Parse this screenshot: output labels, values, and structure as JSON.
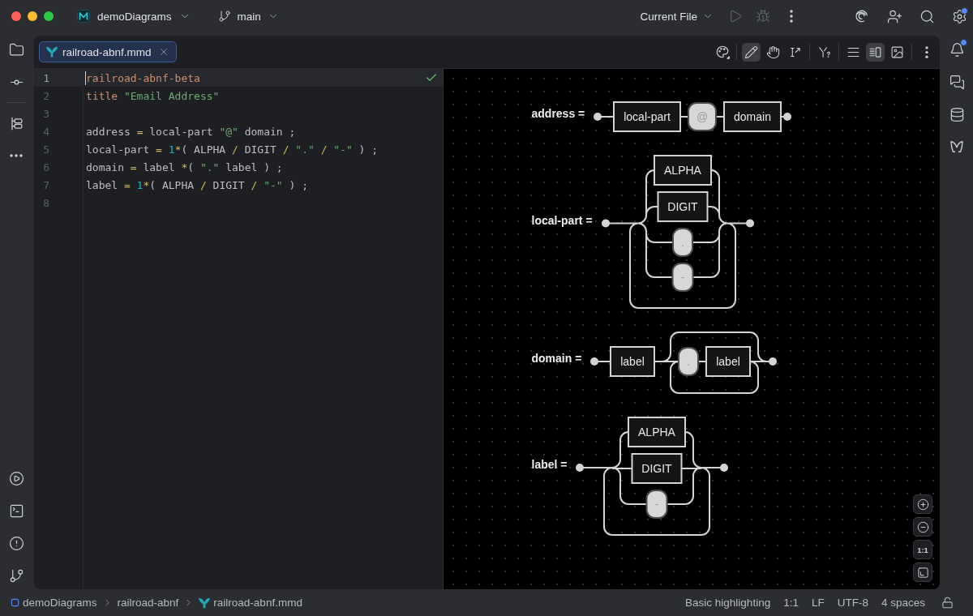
{
  "title_bar": {
    "project": "demoDiagrams",
    "branch": "main",
    "run_configuration": "Current File",
    "run_disabled": true,
    "debug_disabled": true,
    "settings_badge": true
  },
  "right_stripe": {
    "notifications_badge": true
  },
  "editor_tabs": [
    {
      "label": "railroad-abnf.mmd",
      "selected": true
    }
  ],
  "preview_toolbar": {
    "tools": [
      {
        "kind": "draw",
        "selected": true
      },
      {
        "kind": "pan",
        "selected": false
      },
      {
        "kind": "text",
        "selected": false
      }
    ],
    "layouts": [
      {
        "kind": "editor",
        "selected": false
      },
      {
        "kind": "split",
        "selected": true
      },
      {
        "kind": "preview",
        "selected": false
      }
    ]
  },
  "editor": {
    "inspection_passed": true,
    "lines": [
      {
        "number": "1",
        "current": true,
        "tokens": [
          {
            "kind": "keyword",
            "text": "railroad-abnf-beta"
          }
        ]
      },
      {
        "number": "2",
        "current": false,
        "tokens": [
          {
            "kind": "keyword",
            "text": "title"
          },
          {
            "kind": "string",
            "text": " \"Email Address\""
          }
        ]
      },
      {
        "number": "3",
        "current": false
      },
      {
        "number": "4",
        "current": false,
        "tokens": [
          {
            "kind": "plain",
            "text": "address "
          },
          {
            "kind": "operator",
            "text": "="
          },
          {
            "kind": "plain",
            "text": " local-part "
          },
          {
            "kind": "string",
            "text": "\"@\""
          },
          {
            "kind": "plain",
            "text": " domain ;"
          }
        ]
      },
      {
        "number": "5",
        "current": false,
        "tokens": [
          {
            "kind": "plain",
            "text": "local-part "
          },
          {
            "kind": "operator",
            "text": "="
          },
          {
            "kind": "number",
            "text": " 1"
          },
          {
            "kind": "operator",
            "text": "*"
          },
          {
            "kind": "plain",
            "text": "( ALPHA "
          },
          {
            "kind": "operator",
            "text": "/"
          },
          {
            "kind": "plain",
            "text": " DIGIT "
          },
          {
            "kind": "operator",
            "text": "/"
          },
          {
            "kind": "string",
            "text": " \".\" "
          },
          {
            "kind": "operator",
            "text": "/"
          },
          {
            "kind": "string",
            "text": " \"-\""
          },
          {
            "kind": "plain",
            "text": " ) ;"
          }
        ]
      },
      {
        "number": "6",
        "current": false,
        "tokens": [
          {
            "kind": "plain",
            "text": "domain "
          },
          {
            "kind": "operator",
            "text": "="
          },
          {
            "kind": "plain",
            "text": " label "
          },
          {
            "kind": "operator",
            "text": "*"
          },
          {
            "kind": "plain",
            "text": "( "
          },
          {
            "kind": "string",
            "text": "\".\""
          },
          {
            "kind": "plain",
            "text": " label ) ;"
          }
        ]
      },
      {
        "number": "7",
        "current": false,
        "tokens": [
          {
            "kind": "plain",
            "text": "label "
          },
          {
            "kind": "operator",
            "text": "="
          },
          {
            "kind": "number",
            "text": " 1"
          },
          {
            "kind": "operator",
            "text": "*"
          },
          {
            "kind": "plain",
            "text": "( ALPHA "
          },
          {
            "kind": "operator",
            "text": "/"
          },
          {
            "kind": "plain",
            "text": " DIGIT "
          },
          {
            "kind": "operator",
            "text": "/"
          },
          {
            "kind": "string",
            "text": " \"-\""
          },
          {
            "kind": "plain",
            "text": " ) ;"
          }
        ]
      },
      {
        "number": "8",
        "current": false
      }
    ]
  },
  "preview": {
    "rules": [
      {
        "name": "address =",
        "diagram": {
          "kind": "sequence",
          "children": [
            {
              "kind": "nonterminal",
              "text": "local-part"
            },
            {
              "kind": "terminal",
              "text": "@"
            },
            {
              "kind": "nonterminal",
              "text": "domain"
            }
          ]
        }
      },
      {
        "name": "local-part =",
        "diagram": {
          "kind": "repeat",
          "children": [
            {
              "kind": "choice",
              "children": [
                {
                  "kind": "nonterminal",
                  "text": "ALPHA"
                },
                {
                  "kind": "nonterminal",
                  "text": "DIGIT"
                },
                {
                  "kind": "terminal",
                  "text": "."
                },
                {
                  "kind": "terminal",
                  "text": "-"
                }
              ]
            }
          ]
        }
      },
      {
        "name": "domain =",
        "diagram": {
          "kind": "sequence",
          "children": [
            {
              "kind": "nonterminal",
              "text": "label"
            },
            {
              "kind": "optional_repeat",
              "children": [
                {
                  "kind": "sequence",
                  "children": [
                    {
                      "kind": "terminal",
                      "text": "."
                    },
                    {
                      "kind": "nonterminal",
                      "text": "label"
                    }
                  ]
                }
              ]
            }
          ]
        }
      },
      {
        "name": "label =",
        "diagram": {
          "kind": "repeat",
          "children": [
            {
              "kind": "choice",
              "children": [
                {
                  "kind": "nonterminal",
                  "text": "ALPHA"
                },
                {
                  "kind": "nonterminal",
                  "text": "DIGIT"
                },
                {
                  "kind": "terminal",
                  "text": "-"
                }
              ]
            }
          ]
        }
      }
    ],
    "zoom_controls": {
      "actual_size": "1:1"
    }
  },
  "status_bar": {
    "breadcrumbs": [
      {
        "kind": "module",
        "text": "demoDiagrams"
      },
      {
        "kind": "directory",
        "text": "railroad-abnf"
      },
      {
        "kind": "file",
        "text": "railroad-abnf.mmd"
      }
    ],
    "widgets": [
      "Basic highlighting",
      "1:1",
      "LF",
      "UTF-8",
      "4 spaces"
    ]
  }
}
